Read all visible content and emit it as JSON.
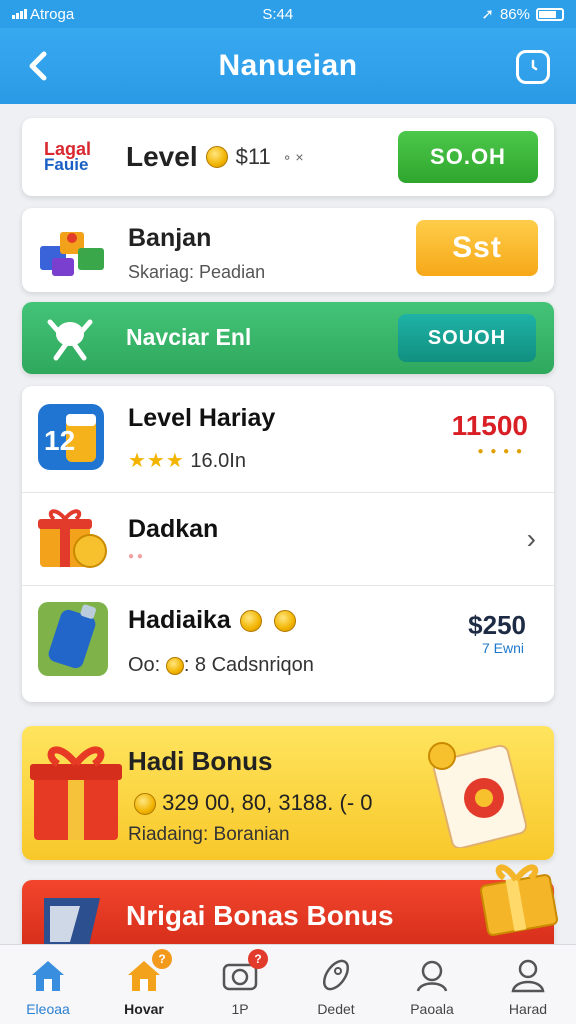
{
  "status_bar": {
    "carrier": "Atroga",
    "time": "S:44",
    "battery": "86%"
  },
  "header": {
    "title": "Nanueian"
  },
  "tiles": {
    "level": {
      "logo_line1": "Lagal",
      "logo_line2": "Fauie",
      "name": "Level",
      "amount": "$11",
      "extra": "∘ ×",
      "button": "SO.OH"
    },
    "banjan": {
      "name": "Banjan",
      "sub": "Skariag: Peadian",
      "button": "Sst"
    },
    "green": {
      "name": "Navciar Enl",
      "button": "SOUOH"
    },
    "list": [
      {
        "name": "Level Hariay",
        "stars": "★★★",
        "sub": "16.0In",
        "amount": "11500",
        "dots": "● ● ● ●"
      },
      {
        "name": "Dadkan",
        "sub": ""
      },
      {
        "name": "Hadiaika",
        "sub_prefix": "Oo:",
        "sub": ": 8 Cadsnriqon",
        "amount": "$250",
        "amount_sub": "7 Ewni"
      }
    ],
    "bonus": {
      "name": "Hadi Bonus",
      "amount": "329 00, 80, 3188. (- 0",
      "sub": "Riadaing: Boranian"
    },
    "red": {
      "name": "Nrigai Bonas Bonus"
    }
  },
  "tabbar": [
    {
      "label": "Eleoaa",
      "icon": "home-icon",
      "active": true
    },
    {
      "label": "Hovar",
      "icon": "home-icon",
      "badge": "?"
    },
    {
      "label": "1P",
      "icon": "camera-icon",
      "badge": "?"
    },
    {
      "label": "Dedet",
      "icon": "rocket-icon"
    },
    {
      "label": "Paoala",
      "icon": "profile-icon"
    },
    {
      "label": "Harad",
      "icon": "user-icon"
    }
  ],
  "colors": {
    "header_blue": "#2d9ee8",
    "green": "#2fa62e",
    "orange": "#f6a818",
    "teal": "#109080",
    "red_amount": "#d91f26",
    "bonus_yellow": "#f8c82a",
    "red_banner": "#d12a18"
  }
}
